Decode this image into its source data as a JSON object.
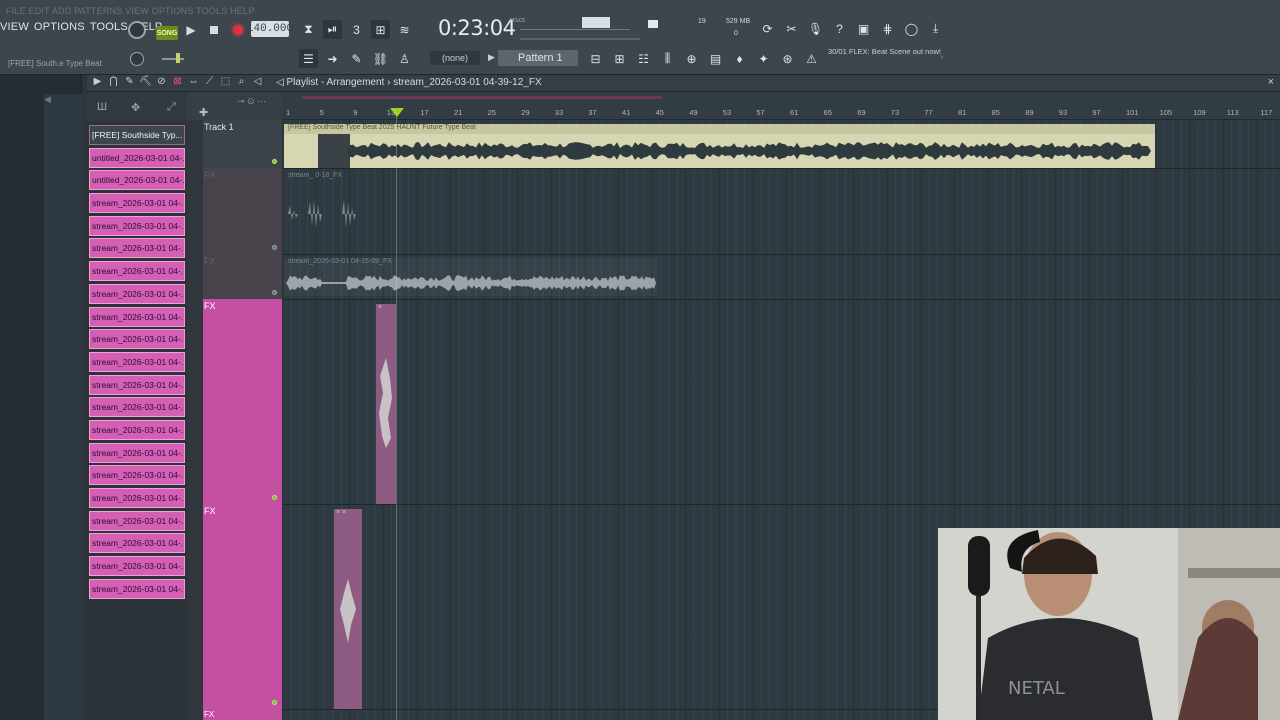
{
  "ghost_menu": "FILE EDIT ADD PATTERNS VIEW OPTIONS TOOLS HELP",
  "menu": [
    "VIEW",
    "OPTIONS",
    "TOOLS",
    "HELP"
  ],
  "transport": {
    "song_label": "SONG",
    "tempo": "140.000",
    "time": "0:23:04",
    "time_unit": "M:S:CS"
  },
  "monitor": {
    "polyphony": "19",
    "ram": "529 MB",
    "zero": "0"
  },
  "hint_label": "[FREE] South.e Type Beat",
  "pattern": {
    "none_label": "(none)",
    "selected": "Pattern 1"
  },
  "news": "30/01  FLEX: Beat Scene out now!",
  "playlist": {
    "title": "Playlist - Arrangement",
    "arrangement": "stream_2026-03-01 04-39-12_FX"
  },
  "ruler_ticks": [
    "1",
    "5",
    "9",
    "13",
    "17",
    "21",
    "25",
    "29",
    "33",
    "37",
    "41",
    "45",
    "49",
    "53",
    "57",
    "61",
    "65",
    "69",
    "73",
    "77",
    "81",
    "85",
    "89",
    "93",
    "97",
    "101",
    "105",
    "109",
    "113",
    "117"
  ],
  "picker_items": [
    "[FREE] Southside Typ...",
    "untitled_2026-03-01 04-...",
    "untitled_2026-03-01 04-...",
    "stream_2026-03-01 04-...",
    "stream_2026-03-01 04-...",
    "stream_2026-03-01 04-...",
    "stream_2026-03-01 04-...",
    "stream_2026-03-01 04-...",
    "stream_2026-03-01 04-...",
    "stream_2026-03-01 04-...",
    "stream_2026-03-01 04-...",
    "stream_2026-03-01 04-...",
    "stream_2026-03-01 04-...",
    "stream_2026-03-01 04-...",
    "stream_2026-03-01 04-...",
    "stream_2026-03-01 04-...",
    "stream_2026-03-01 04-...",
    "stream_2026-03-01 04-...",
    "stream_2026-03-01 04-...",
    "stream_2026-03-01 04-...",
    "stream_2026-03-01 04-..."
  ],
  "tracks": {
    "track1": "Track 1",
    "fx": "FX",
    "dim_label": "FX"
  },
  "clips": {
    "beat": "[FREE] Southside Type Beat 2025 HAUNT Future Type Beat",
    "stream1": "stream_ 0-18_FX",
    "stream2": "stream_2026-03-01 04-15-09_FX"
  },
  "colors": {
    "accent_pink": "#d45fb5",
    "beat_clip": "#d7d6b3",
    "playhead": "#9bd22c",
    "record": "#e0303c",
    "song": "#6c8d1d"
  }
}
